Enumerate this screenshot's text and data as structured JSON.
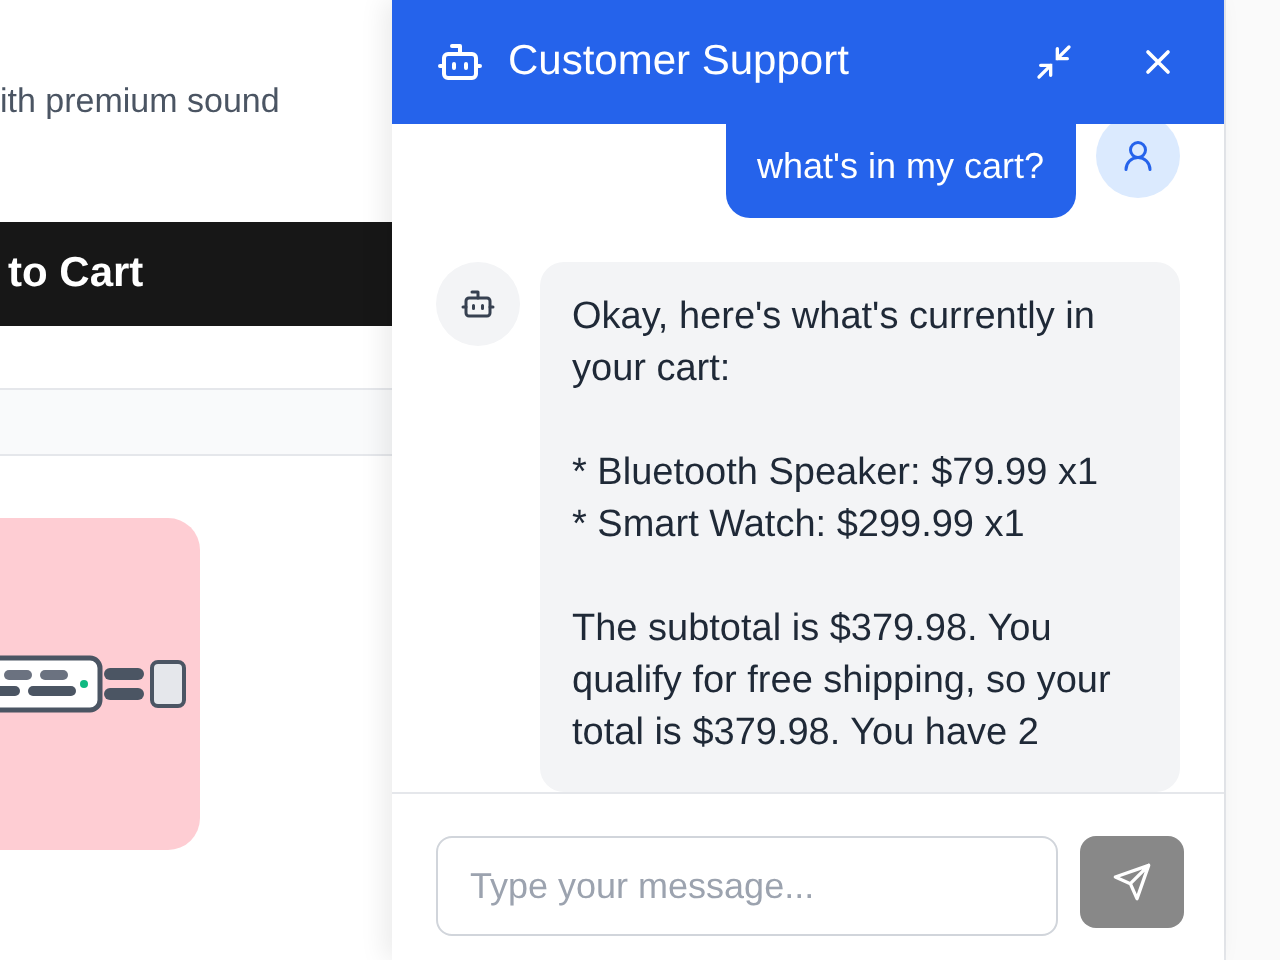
{
  "page": {
    "description": "ith premium sound",
    "add_to_cart": "to Cart"
  },
  "chat": {
    "title": "Customer Support",
    "messages": [
      {
        "kind": "user",
        "paragraphs": [
          [
            "what's in my cart?"
          ]
        ]
      },
      {
        "kind": "bot",
        "paragraphs": [
          [
            "Okay, here's what's currently in your cart:"
          ],
          [
            "* Bluetooth Speaker: $79.99 x1",
            "* Smart Watch: $299.99 x1"
          ],
          [
            "The subtotal is $379.98. You qualify for free shipping, so your total is $379.98. You have 2"
          ]
        ]
      }
    ],
    "input": {
      "placeholder": "Type your message..."
    },
    "send_disabled": true
  }
}
